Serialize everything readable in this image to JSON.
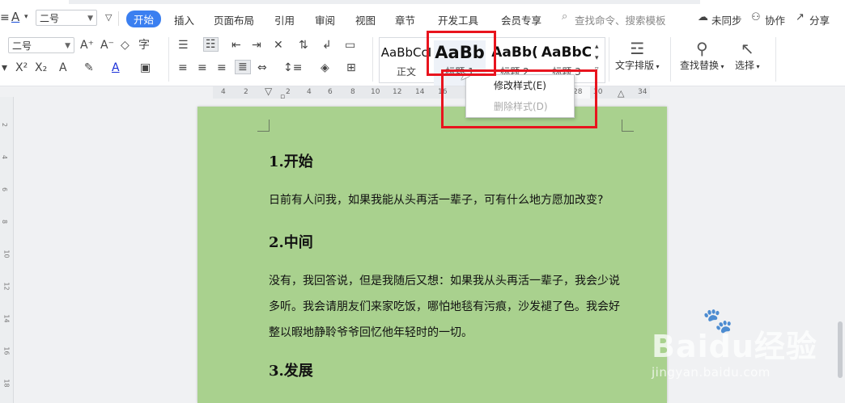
{
  "menubar": {
    "font_name": "二号",
    "tabs": [
      {
        "label": "开始",
        "active": true
      },
      {
        "label": "插入"
      },
      {
        "label": "页面布局"
      },
      {
        "label": "引用"
      },
      {
        "label": "审阅"
      },
      {
        "label": "视图"
      },
      {
        "label": "章节"
      },
      {
        "label": "开发工具"
      },
      {
        "label": "会员专享"
      }
    ],
    "search_placeholder": "查找命令、搜索模板",
    "sync_label": "未同步",
    "collab_label": "协作",
    "share_label": "分享"
  },
  "ribbon": {
    "font_size": "二号",
    "styles": [
      {
        "preview": "AaBbCcI",
        "label": "正文"
      },
      {
        "preview": "AaBb",
        "label": "标题 1"
      },
      {
        "preview": "AaBb(",
        "label": "标题 2"
      },
      {
        "preview": "AaBbC",
        "label": "标题 3"
      }
    ],
    "text_layout_label": "文字排版",
    "find_replace_label": "查找替换",
    "select_label": "选择"
  },
  "ruler": {
    "numbers": [
      "4",
      "2",
      "2",
      "4",
      "6",
      "8",
      "10",
      "12",
      "14",
      "16",
      "28",
      "30",
      "34"
    ]
  },
  "context_menu": {
    "items": [
      {
        "label": "修改样式(E)",
        "enabled": true
      },
      {
        "label": "删除样式(D)",
        "enabled": false
      }
    ]
  },
  "document": {
    "heading1": "1.开始",
    "para1": "日前有人问我，如果我能从头再活一辈子，可有什么地方愿加改变?",
    "heading2": "2.中间",
    "para2": "没有，我回答说，但是我随后又想：如果我从头再活一辈子，我会少说多听。我会请朋友们来家吃饭，哪怕地毯有污痕，沙发褪了色。我会好整以暇地静聆爷爷回忆他年轻时的一切。",
    "heading3": "3.发展"
  },
  "watermark": {
    "brand": "Baidu经验",
    "url": "jingyan.baidu.com"
  },
  "colors": {
    "accent": "#3b7ff0",
    "page_bg": "#a9d18e",
    "highlight": "#e8141e"
  }
}
